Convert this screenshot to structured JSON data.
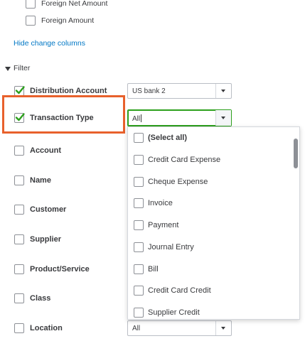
{
  "change_columns": [
    {
      "label": "Foreign Net Amount",
      "checked": false
    },
    {
      "label": "Foreign Amount",
      "checked": false
    }
  ],
  "hide_change_columns_label": "Hide change columns",
  "filter": {
    "title": "Filter",
    "rows": [
      {
        "label": "Distribution Account",
        "checked": true,
        "value": "US bank 2"
      },
      {
        "label": "Transaction Type",
        "checked": true,
        "value": "All"
      },
      {
        "label": "Account",
        "checked": false
      },
      {
        "label": "Name",
        "checked": false
      },
      {
        "label": "Customer",
        "checked": false
      },
      {
        "label": "Supplier",
        "checked": false
      },
      {
        "label": "Product/Service",
        "checked": false
      },
      {
        "label": "Class",
        "checked": false
      },
      {
        "label": "Location",
        "checked": false,
        "value": "All"
      }
    ]
  },
  "transaction_type_options": [
    "(Select all)",
    "Credit Card Expense",
    "Cheque Expense",
    "Invoice",
    "Payment",
    "Journal Entry",
    "Bill",
    "Credit Card Credit",
    "Supplier Credit"
  ],
  "colors": {
    "accent_green": "#2ca01c",
    "link_blue": "#0077c5",
    "highlight_orange": "#e8612c"
  }
}
